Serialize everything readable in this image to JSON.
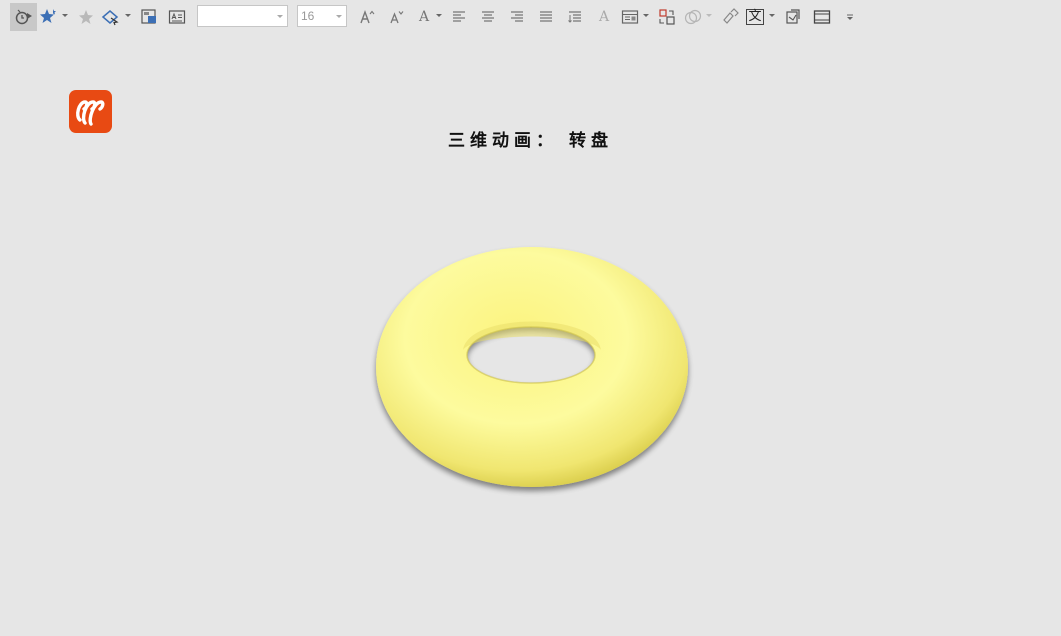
{
  "toolbar": {
    "font_name_value": "",
    "font_size_value": "16",
    "text_glyph_label": "A",
    "chinese_char_label": "文"
  },
  "slide": {
    "title": "三维动画： 转盘"
  },
  "colors": {
    "background": "#e6e6e6",
    "logo": "#e84a13",
    "torus_light": "#fdfba0",
    "torus_mid": "#f6ef7a",
    "torus_dark": "#d9cc45"
  }
}
